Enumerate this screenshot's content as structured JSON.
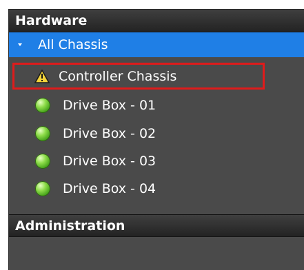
{
  "hardware": {
    "header_label": "Hardware",
    "root_label": "All Chassis",
    "items": [
      {
        "label": "Controller Chassis",
        "status": "warning",
        "icon": "warning-triangle-icon"
      },
      {
        "label": "Drive Box - 01",
        "status": "ok",
        "icon": "green-status-icon"
      },
      {
        "label": "Drive Box - 02",
        "status": "ok",
        "icon": "green-status-icon"
      },
      {
        "label": "Drive Box - 03",
        "status": "ok",
        "icon": "green-status-icon"
      },
      {
        "label": "Drive Box - 04",
        "status": "ok",
        "icon": "green-status-icon"
      }
    ]
  },
  "administration": {
    "header_label": "Administration"
  },
  "colors": {
    "panel_background": "#4a4a4a",
    "selected_root_background": "#1f7fe6",
    "highlight_border": "#e01b1b",
    "warning_yellow": "#f3d33a",
    "ok_green": "#5bbf25"
  }
}
